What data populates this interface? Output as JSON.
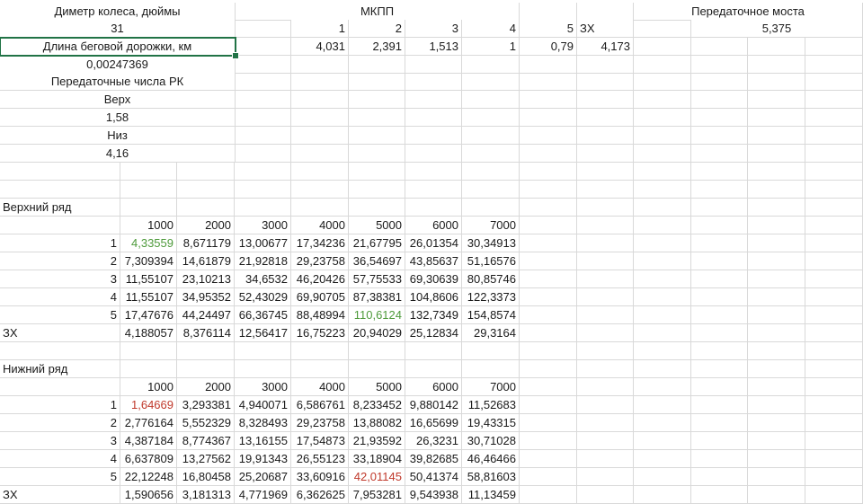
{
  "sheet": {
    "selected_cell": "A3",
    "rows": [
      {
        "cells": [
          {
            "col": "A",
            "span": 1,
            "text": "Диметр колеса, дюймы",
            "align": "c"
          },
          {
            "col": "F",
            "span": 2,
            "text": "МКПП",
            "align": "c"
          },
          {
            "col": "M",
            "span": 2,
            "text": "Передаточное моста",
            "align": "c"
          }
        ]
      },
      {
        "cells": [
          {
            "col": "A",
            "text": "31",
            "align": "c"
          },
          {
            "col": "C",
            "text": "1",
            "align": "r"
          },
          {
            "col": "D",
            "text": "2",
            "align": "r"
          },
          {
            "col": "E",
            "text": "3",
            "align": "r"
          },
          {
            "col": "F",
            "text": "4",
            "align": "r"
          },
          {
            "col": "G",
            "text": "5",
            "align": "r"
          },
          {
            "col": "H",
            "text": "ЗХ",
            "align": "l"
          },
          {
            "col": "M",
            "span": 2,
            "text": "5,375",
            "align": "c"
          }
        ]
      },
      {
        "cells": [
          {
            "col": "A",
            "text": "Длина беговой дорожки, км",
            "align": "c"
          },
          {
            "col": "C",
            "text": "4,031",
            "align": "r"
          },
          {
            "col": "D",
            "text": "2,391",
            "align": "r"
          },
          {
            "col": "E",
            "text": "1,513",
            "align": "r"
          },
          {
            "col": "F",
            "text": "1",
            "align": "r"
          },
          {
            "col": "G",
            "text": "0,79",
            "align": "r"
          },
          {
            "col": "H",
            "text": "4,173",
            "align": "r"
          }
        ]
      },
      {
        "cells": [
          {
            "col": "A",
            "text": "0,00247369",
            "align": "c"
          }
        ]
      },
      {
        "cells": [
          {
            "col": "A",
            "text": "Передаточные числа РК",
            "align": "c"
          }
        ]
      },
      {
        "cells": [
          {
            "col": "A",
            "text": "Верх",
            "align": "c"
          }
        ]
      },
      {
        "cells": [
          {
            "col": "A",
            "text": "1,58",
            "align": "c"
          }
        ]
      },
      {
        "cells": [
          {
            "col": "A",
            "text": "Низ",
            "align": "c"
          }
        ]
      },
      {
        "cells": [
          {
            "col": "A",
            "text": "4,16",
            "align": "c"
          }
        ]
      },
      {
        "cells": []
      },
      {
        "cells": []
      },
      {
        "cells": [
          {
            "col": "A",
            "text": "Верхний ряд",
            "align": "l"
          }
        ]
      },
      {
        "cells": [
          {
            "col": "B",
            "text": "1000",
            "align": "r"
          },
          {
            "col": "C",
            "text": "2000",
            "align": "r"
          },
          {
            "col": "D",
            "text": "3000",
            "align": "r"
          },
          {
            "col": "E",
            "text": "4000",
            "align": "r"
          },
          {
            "col": "F",
            "text": "5000",
            "align": "r"
          },
          {
            "col": "G",
            "text": "6000",
            "align": "r"
          },
          {
            "col": "H",
            "text": "7000",
            "align": "r"
          }
        ]
      },
      {
        "cells": [
          {
            "col": "A",
            "text": "1",
            "align": "r"
          },
          {
            "col": "B",
            "text": "4,33559",
            "align": "r",
            "color": "green"
          },
          {
            "col": "C",
            "text": "8,671179",
            "align": "r"
          },
          {
            "col": "D",
            "text": "13,00677",
            "align": "r"
          },
          {
            "col": "E",
            "text": "17,34236",
            "align": "r"
          },
          {
            "col": "F",
            "text": "21,67795",
            "align": "r"
          },
          {
            "col": "G",
            "text": "26,01354",
            "align": "r"
          },
          {
            "col": "H",
            "text": "30,34913",
            "align": "r"
          }
        ]
      },
      {
        "cells": [
          {
            "col": "A",
            "text": "2",
            "align": "r"
          },
          {
            "col": "B",
            "text": "7,309394",
            "align": "r"
          },
          {
            "col": "C",
            "text": "14,61879",
            "align": "r"
          },
          {
            "col": "D",
            "text": "21,92818",
            "align": "r"
          },
          {
            "col": "E",
            "text": "29,23758",
            "align": "r"
          },
          {
            "col": "F",
            "text": "36,54697",
            "align": "r"
          },
          {
            "col": "G",
            "text": "43,85637",
            "align": "r"
          },
          {
            "col": "H",
            "text": "51,16576",
            "align": "r"
          }
        ]
      },
      {
        "cells": [
          {
            "col": "A",
            "text": "3",
            "align": "r"
          },
          {
            "col": "B",
            "text": "11,55107",
            "align": "r"
          },
          {
            "col": "C",
            "text": "23,10213",
            "align": "r"
          },
          {
            "col": "D",
            "text": "34,6532",
            "align": "r"
          },
          {
            "col": "E",
            "text": "46,20426",
            "align": "r"
          },
          {
            "col": "F",
            "text": "57,75533",
            "align": "r"
          },
          {
            "col": "G",
            "text": "69,30639",
            "align": "r"
          },
          {
            "col": "H",
            "text": "80,85746",
            "align": "r"
          }
        ]
      },
      {
        "cells": [
          {
            "col": "A",
            "text": "4",
            "align": "r"
          },
          {
            "col": "B",
            "text": "11,55107",
            "align": "r"
          },
          {
            "col": "C",
            "text": "34,95352",
            "align": "r"
          },
          {
            "col": "D",
            "text": "52,43029",
            "align": "r"
          },
          {
            "col": "E",
            "text": "69,90705",
            "align": "r"
          },
          {
            "col": "F",
            "text": "87,38381",
            "align": "r"
          },
          {
            "col": "G",
            "text": "104,8606",
            "align": "r"
          },
          {
            "col": "H",
            "text": "122,3373",
            "align": "r"
          }
        ]
      },
      {
        "cells": [
          {
            "col": "A",
            "text": "5",
            "align": "r"
          },
          {
            "col": "B",
            "text": "17,47676",
            "align": "r"
          },
          {
            "col": "C",
            "text": "44,24497",
            "align": "r"
          },
          {
            "col": "D",
            "text": "66,36745",
            "align": "r"
          },
          {
            "col": "E",
            "text": "88,48994",
            "align": "r"
          },
          {
            "col": "F",
            "text": "110,6124",
            "align": "r",
            "color": "green"
          },
          {
            "col": "G",
            "text": "132,7349",
            "align": "r"
          },
          {
            "col": "H",
            "text": "154,8574",
            "align": "r"
          }
        ]
      },
      {
        "cells": [
          {
            "col": "A",
            "text": "ЗХ",
            "align": "l"
          },
          {
            "col": "B",
            "text": "4,188057",
            "align": "r"
          },
          {
            "col": "C",
            "text": "8,376114",
            "align": "r"
          },
          {
            "col": "D",
            "text": "12,56417",
            "align": "r"
          },
          {
            "col": "E",
            "text": "16,75223",
            "align": "r"
          },
          {
            "col": "F",
            "text": "20,94029",
            "align": "r"
          },
          {
            "col": "G",
            "text": "25,12834",
            "align": "r"
          },
          {
            "col": "H",
            "text": "29,3164",
            "align": "r"
          }
        ]
      },
      {
        "cells": []
      },
      {
        "cells": [
          {
            "col": "A",
            "text": "Нижний ряд",
            "align": "l"
          }
        ]
      },
      {
        "cells": [
          {
            "col": "B",
            "text": "1000",
            "align": "r"
          },
          {
            "col": "C",
            "text": "2000",
            "align": "r"
          },
          {
            "col": "D",
            "text": "3000",
            "align": "r"
          },
          {
            "col": "E",
            "text": "4000",
            "align": "r"
          },
          {
            "col": "F",
            "text": "5000",
            "align": "r"
          },
          {
            "col": "G",
            "text": "6000",
            "align": "r"
          },
          {
            "col": "H",
            "text": "7000",
            "align": "r"
          }
        ]
      },
      {
        "cells": [
          {
            "col": "A",
            "text": "1",
            "align": "r"
          },
          {
            "col": "B",
            "text": "1,64669",
            "align": "r",
            "color": "red"
          },
          {
            "col": "C",
            "text": "3,293381",
            "align": "r"
          },
          {
            "col": "D",
            "text": "4,940071",
            "align": "r"
          },
          {
            "col": "E",
            "text": "6,586761",
            "align": "r"
          },
          {
            "col": "F",
            "text": "8,233452",
            "align": "r"
          },
          {
            "col": "G",
            "text": "9,880142",
            "align": "r"
          },
          {
            "col": "H",
            "text": "11,52683",
            "align": "r"
          }
        ]
      },
      {
        "cells": [
          {
            "col": "A",
            "text": "2",
            "align": "r"
          },
          {
            "col": "B",
            "text": "2,776164",
            "align": "r"
          },
          {
            "col": "C",
            "text": "5,552329",
            "align": "r"
          },
          {
            "col": "D",
            "text": "8,328493",
            "align": "r"
          },
          {
            "col": "E",
            "text": "29,23758",
            "align": "r"
          },
          {
            "col": "F",
            "text": "13,88082",
            "align": "r"
          },
          {
            "col": "G",
            "text": "16,65699",
            "align": "r"
          },
          {
            "col": "H",
            "text": "19,43315",
            "align": "r"
          }
        ]
      },
      {
        "cells": [
          {
            "col": "A",
            "text": "3",
            "align": "r"
          },
          {
            "col": "B",
            "text": "4,387184",
            "align": "r"
          },
          {
            "col": "C",
            "text": "8,774367",
            "align": "r"
          },
          {
            "col": "D",
            "text": "13,16155",
            "align": "r"
          },
          {
            "col": "E",
            "text": "17,54873",
            "align": "r"
          },
          {
            "col": "F",
            "text": "21,93592",
            "align": "r"
          },
          {
            "col": "G",
            "text": "26,3231",
            "align": "r"
          },
          {
            "col": "H",
            "text": "30,71028",
            "align": "r"
          }
        ]
      },
      {
        "cells": [
          {
            "col": "A",
            "text": "4",
            "align": "r"
          },
          {
            "col": "B",
            "text": "6,637809",
            "align": "r"
          },
          {
            "col": "C",
            "text": "13,27562",
            "align": "r"
          },
          {
            "col": "D",
            "text": "19,91343",
            "align": "r"
          },
          {
            "col": "E",
            "text": "26,55123",
            "align": "r"
          },
          {
            "col": "F",
            "text": "33,18904",
            "align": "r"
          },
          {
            "col": "G",
            "text": "39,82685",
            "align": "r"
          },
          {
            "col": "H",
            "text": "46,46466",
            "align": "r"
          }
        ]
      },
      {
        "cells": [
          {
            "col": "A",
            "text": "5",
            "align": "r"
          },
          {
            "col": "B",
            "text": "22,12248",
            "align": "r"
          },
          {
            "col": "C",
            "text": "16,80458",
            "align": "r"
          },
          {
            "col": "D",
            "text": "25,20687",
            "align": "r"
          },
          {
            "col": "E",
            "text": "33,60916",
            "align": "r"
          },
          {
            "col": "F",
            "text": "42,01145",
            "align": "r",
            "color": "red"
          },
          {
            "col": "G",
            "text": "50,41374",
            "align": "r"
          },
          {
            "col": "H",
            "text": "58,81603",
            "align": "r"
          }
        ]
      },
      {
        "cells": [
          {
            "col": "A",
            "text": "ЗХ",
            "align": "l"
          },
          {
            "col": "B",
            "text": "1,590656",
            "align": "r"
          },
          {
            "col": "C",
            "text": "3,181313",
            "align": "r"
          },
          {
            "col": "D",
            "text": "4,771969",
            "align": "r"
          },
          {
            "col": "E",
            "text": "6,362625",
            "align": "r"
          },
          {
            "col": "F",
            "text": "7,953281",
            "align": "r"
          },
          {
            "col": "G",
            "text": "9,543938",
            "align": "r"
          },
          {
            "col": "H",
            "text": "11,13459",
            "align": "r"
          }
        ]
      }
    ]
  }
}
